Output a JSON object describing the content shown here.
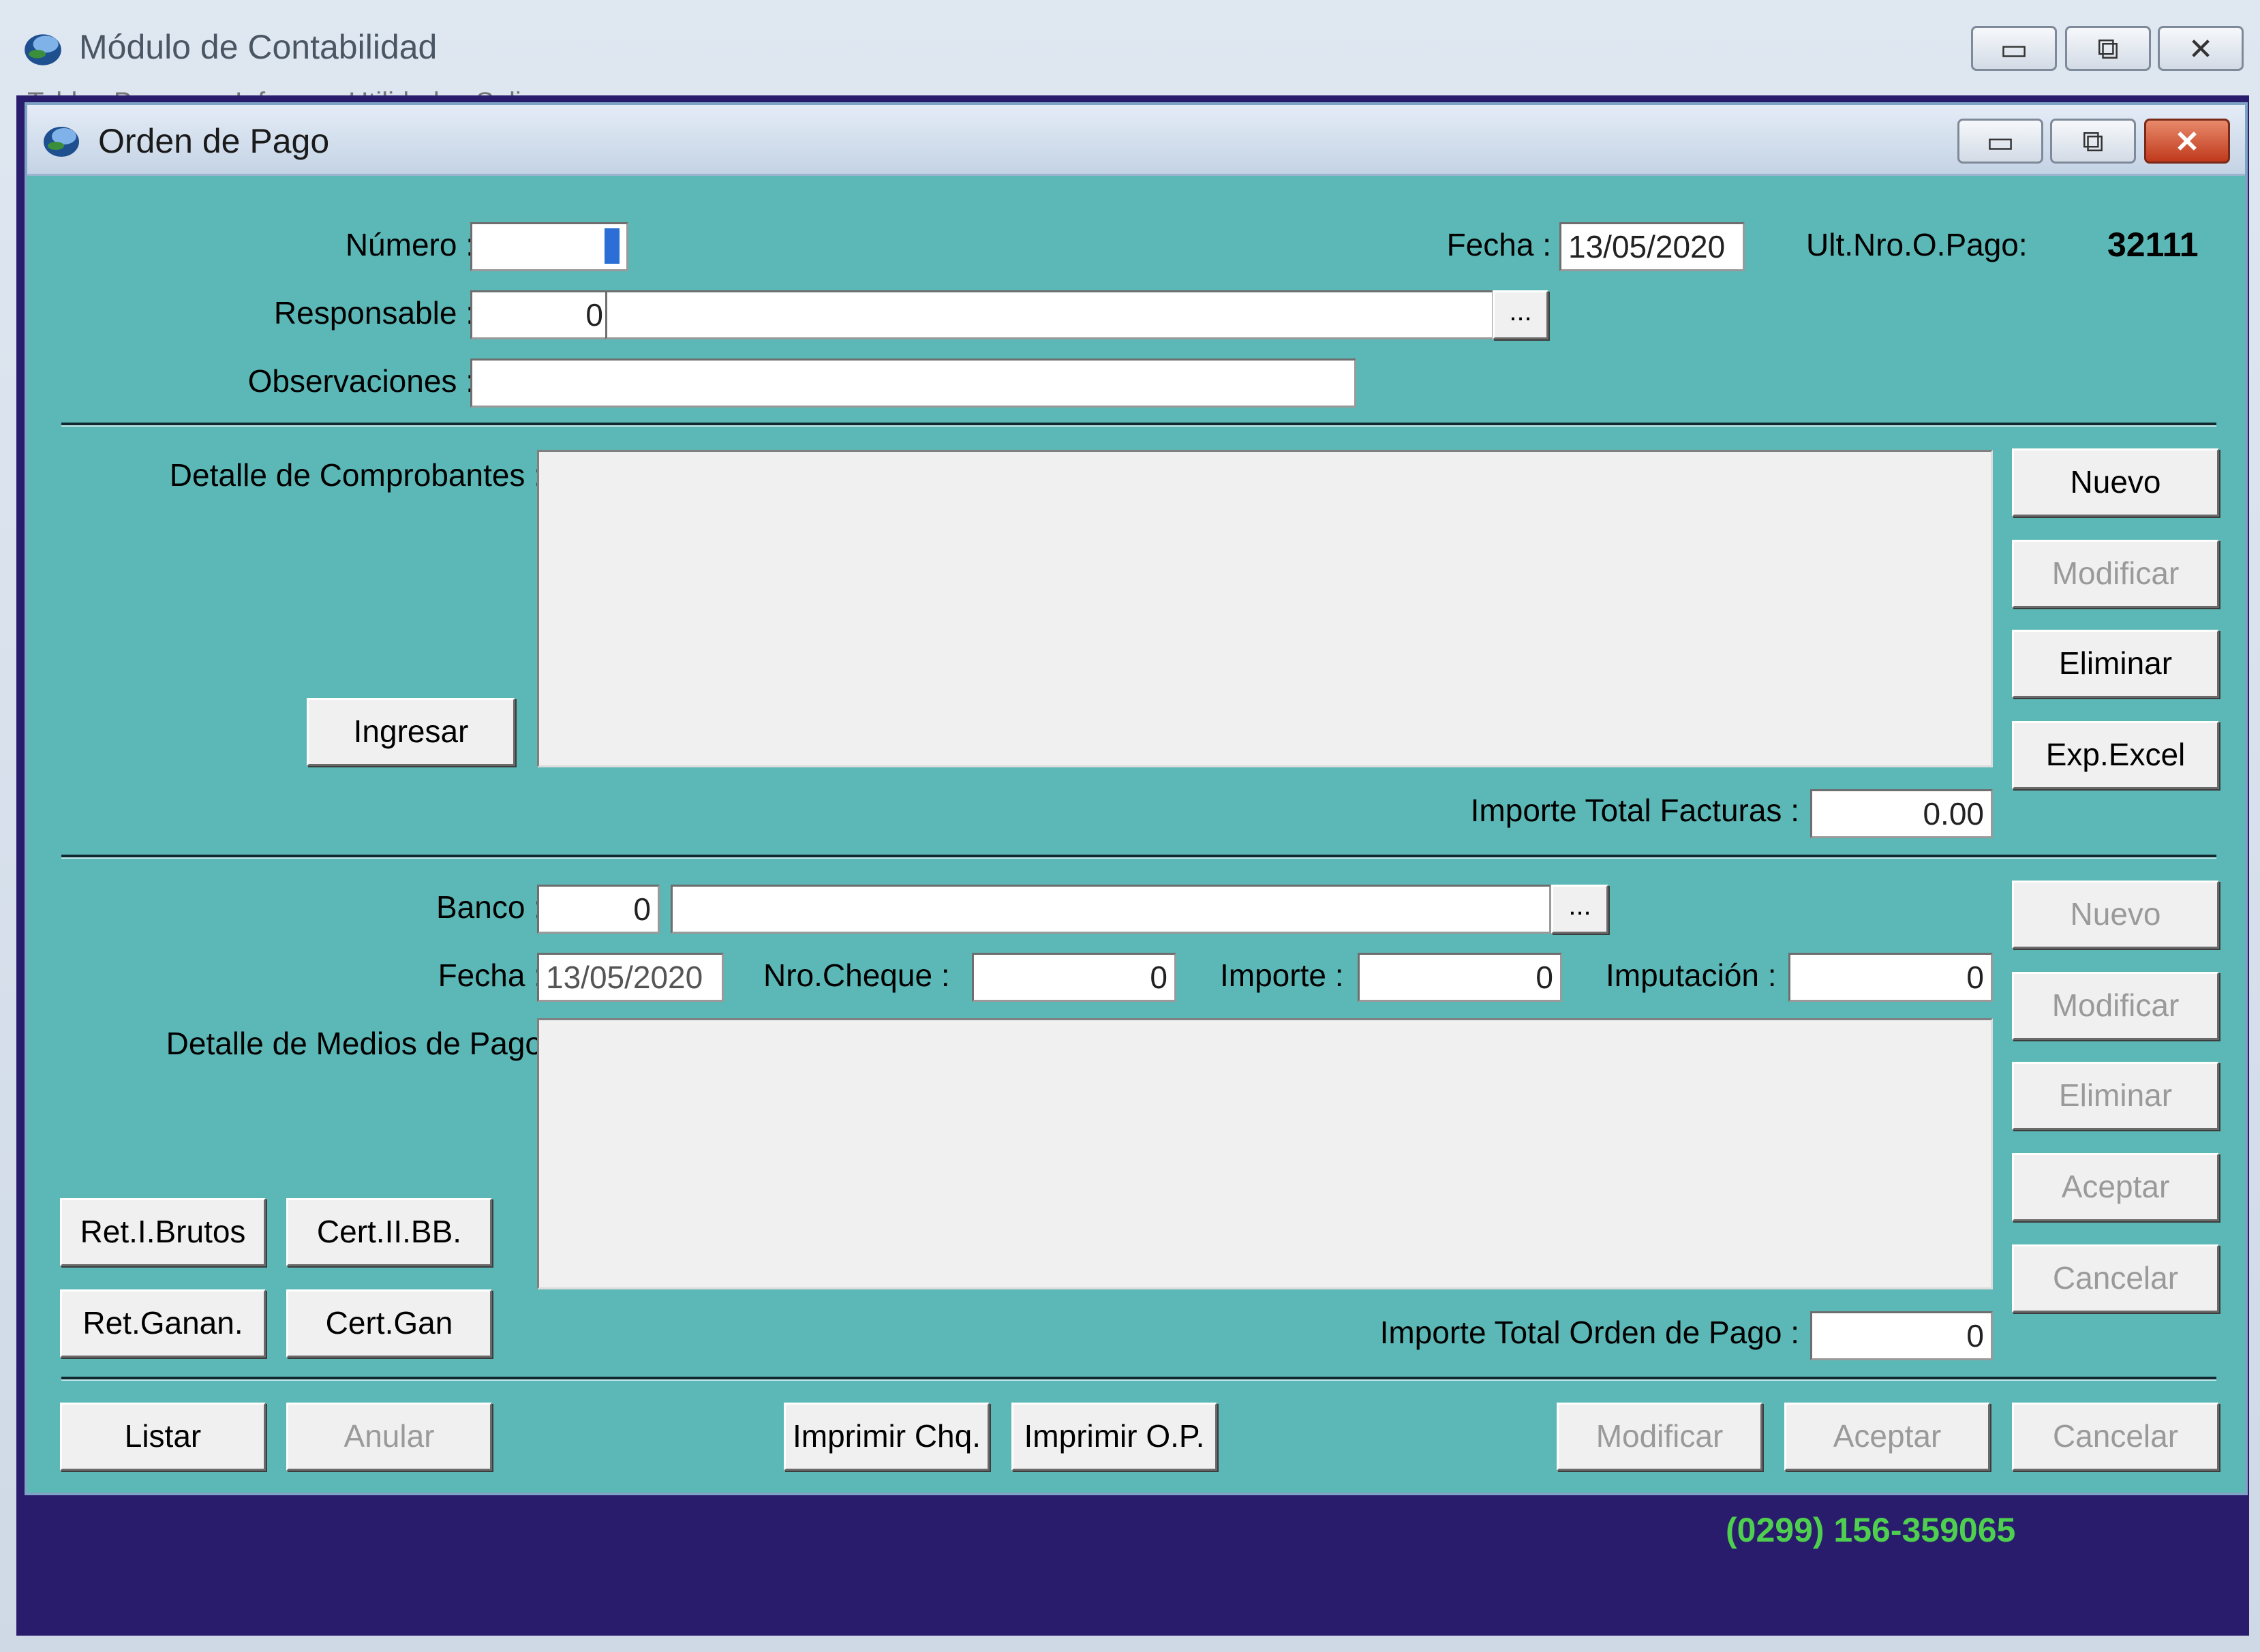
{
  "outer_window": {
    "title": "Módulo de Contabilidad",
    "menu_partial": "Tablas   Procesos   Informes   Utilidades   Salir"
  },
  "window_buttons": {
    "minimize": "▭",
    "restore": "⧉",
    "close": "✕"
  },
  "dialog": {
    "title": "Orden de Pago",
    "header": {
      "numero_label": "Número :",
      "numero_value": "",
      "fecha_label": "Fecha :",
      "fecha_value": "13/05/2020",
      "ult_label": "Ult.Nro.O.Pago:",
      "ult_value": "32111",
      "responsable_label": "Responsable :",
      "responsable_code": "0",
      "responsable_name": "",
      "browse_label": "...",
      "observaciones_label": "Observaciones :",
      "observaciones_value": ""
    },
    "comprobantes": {
      "label": "Detalle de Comprobantes :",
      "ingresar": "Ingresar",
      "buttons": {
        "nuevo": "Nuevo",
        "modificar": "Modificar",
        "eliminar": "Eliminar",
        "exp_excel": "Exp.Excel"
      },
      "total_label": "Importe Total Facturas :",
      "total_value": "0.00"
    },
    "medios": {
      "banco_label": "Banco :",
      "banco_code": "0",
      "banco_name": "",
      "browse_label": "...",
      "fecha_label": "Fecha :",
      "fecha_value": "13/05/2020",
      "cheque_label": "Nro.Cheque :",
      "cheque_value": "0",
      "importe_label": "Importe :",
      "importe_value": "0",
      "imputacion_label": "Imputación :",
      "imputacion_value": "0",
      "detalle_label": "Detalle de Medios de Pago",
      "buttons": {
        "nuevo": "Nuevo",
        "modificar": "Modificar",
        "eliminar": "Eliminar",
        "aceptar": "Aceptar",
        "cancelar": "Cancelar"
      },
      "ret_brutos": "Ret.I.Brutos",
      "cert_iibb": "Cert.II.BB.",
      "ret_ganan": "Ret.Ganan.",
      "cert_gan": "Cert.Gan",
      "total_label": "Importe Total Orden de Pago :",
      "total_value": "0"
    },
    "footer": {
      "listar": "Listar",
      "anular": "Anular",
      "imprimir_chq": "Imprimir Chq.",
      "imprimir_op": "Imprimir O.P.",
      "modificar": "Modificar",
      "aceptar": "Aceptar",
      "cancelar": "Cancelar"
    }
  },
  "status": {
    "phone": "(0299) 156-359065"
  },
  "colors": {
    "dialog_bg": "#5bb8b7",
    "desktop_bg": "#2a1c6d",
    "phone_text": "#4ecf4e"
  }
}
